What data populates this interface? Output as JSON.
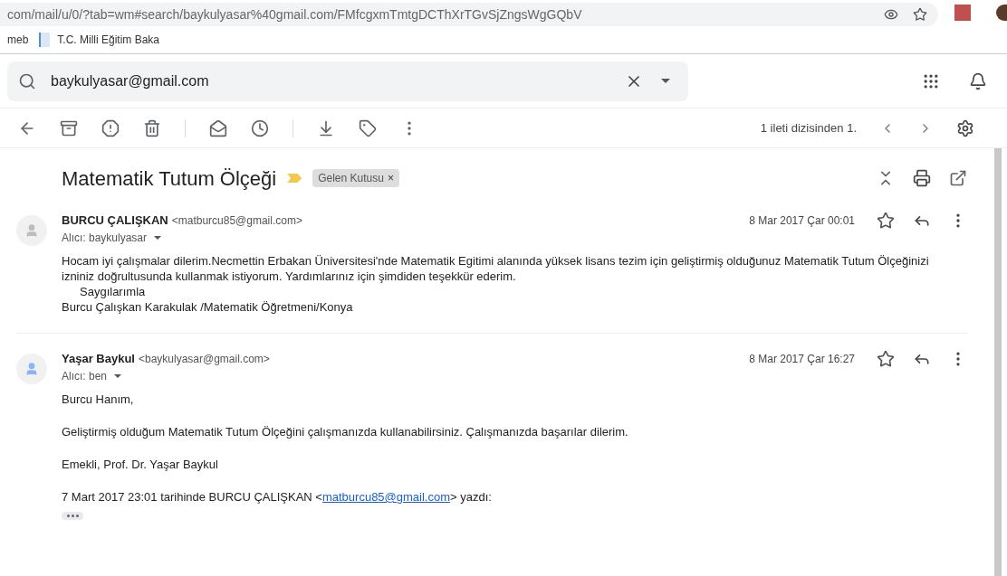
{
  "browser": {
    "url": "com/mail/u/0/?tab=wm#search/baykulyasar%40gmail.com/FMfcgxmTmtgDCThXrTGvSjZngsWgGQbV",
    "bookmarks": [
      "meb",
      "T.C. Milli Eğitim Baka"
    ]
  },
  "search": {
    "value": "baykulyasar@gmail.com"
  },
  "toolbar": {
    "counter": "1 ileti dizisinden 1."
  },
  "thread": {
    "subject": "Matematik Tutum Ölçeği",
    "label": "Gelen Kutusu",
    "label_remove": "×"
  },
  "messages": [
    {
      "sender": "BURCU ÇALIŞKAN",
      "email": "<matburcu85@gmail.com>",
      "to": "Alıcı: baykulyasar",
      "date": "8 Mar 2017 Çar 00:01",
      "color": "#bdbdbd",
      "starred": false,
      "body": [
        {
          "kind": "line",
          "text": "Hocam iyi çalışmalar dilerim.Necmettin Erbakan Üniversitesi'nde Matematik Egitimi alanında yüksek lisans tezim için geliştirmiş olduğunuz Matematik Tutum Ölçeğinizi"
        },
        {
          "kind": "line",
          "text": "izniniz doğrultusunda kullanmak istiyorum. Yardımlarınız için şimdiden teşekkür ederim."
        },
        {
          "kind": "indent",
          "text": "Saygılarımla"
        },
        {
          "kind": "line",
          "text": "Burcu Çalışkan Karakulak /Matematik Öğretmeni/Konya"
        }
      ]
    },
    {
      "sender": "Yaşar Baykul",
      "email": "<baykulyasar@gmail.com>",
      "to": "Alıcı: ben",
      "date": "8 Mar 2017 Çar 16:27",
      "color": "#8ab4f8",
      "starred": false,
      "body": [
        {
          "kind": "para",
          "text": "Burcu Hanım,"
        },
        {
          "kind": "para",
          "text": "Geliştirmiş olduğum Matematik Tutum Ölçeğini çalışmanızda kullanabilirsiniz. Çalışmanızda başarılar dilerim."
        },
        {
          "kind": "para",
          "text": "Emekli, Prof. Dr. Yaşar Baykul"
        },
        {
          "kind": "quote",
          "before": "7 Mart 2017 23:01 tarihinde BURCU ÇALIŞKAN <",
          "link": "matburcu85@gmail.com",
          "after": "> yazdı:"
        },
        {
          "kind": "more"
        }
      ]
    }
  ]
}
